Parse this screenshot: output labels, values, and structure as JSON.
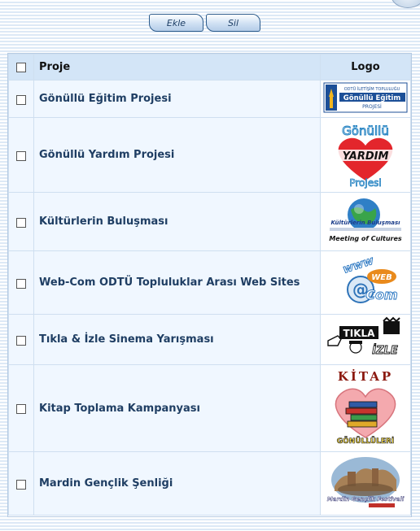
{
  "toolbar": {
    "add_label": "Ekle",
    "delete_label": "Sil"
  },
  "table": {
    "col_project": "Proje",
    "col_logo": "Logo",
    "rows": [
      {
        "name": "Gönüllü Eğitim Projesi",
        "logo_texts": [
          "ODTÜ İLETİŞİM TOPLULUĞU",
          "Gönüllü Eğitim",
          "PROJESİ"
        ]
      },
      {
        "name": "Gönüllü Yardım Projesi",
        "logo_texts": [
          "Gönüllü",
          "YARDIM",
          "Projesi"
        ]
      },
      {
        "name": "Kültürlerin Buluşması",
        "logo_texts": [
          "Kültürlerin Buluşması",
          "Meeting of Cultures"
        ]
      },
      {
        "name": "Web-Com ODTÜ Topluluklar Arası Web Sites",
        "logo_texts": [
          "www",
          "WEB",
          "Com"
        ]
      },
      {
        "name": "Tıkla & İzle Sinema Yarışması",
        "logo_texts": [
          "TIKLA",
          "İZLE"
        ]
      },
      {
        "name": "Kitap Toplama Kampanyası",
        "logo_texts": [
          "KİTAP",
          "GÖNÜLLÜLERİ"
        ]
      },
      {
        "name": "Mardin Gençlik Şenliği",
        "logo_texts": [
          "Mardin Gençlik Festivali"
        ]
      }
    ]
  }
}
